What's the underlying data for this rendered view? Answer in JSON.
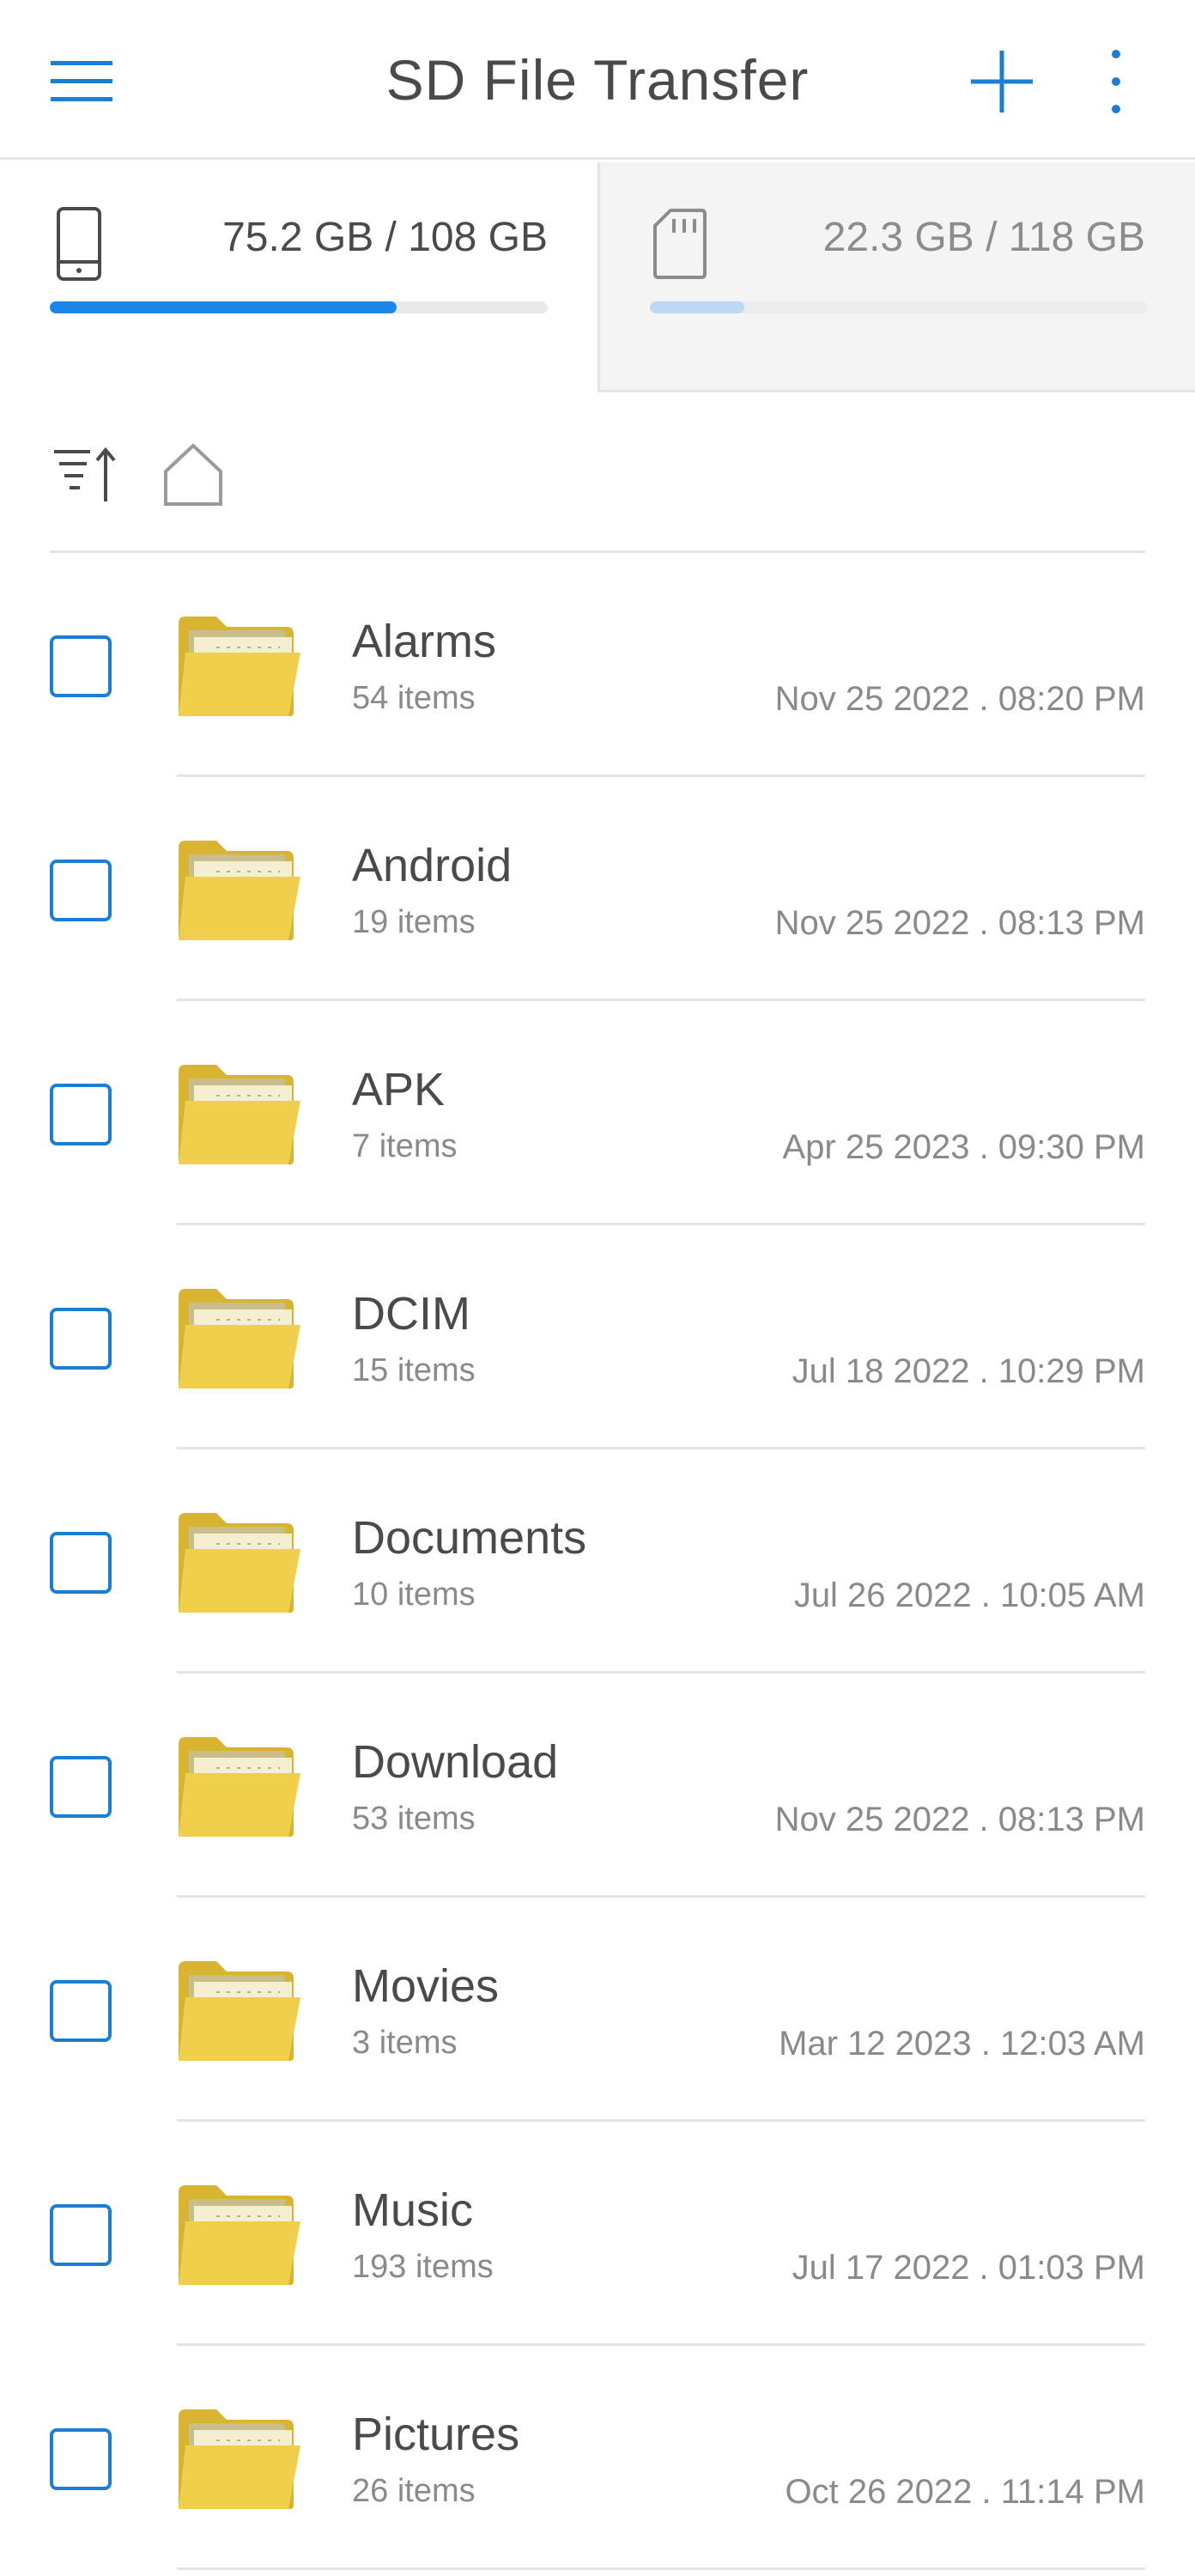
{
  "header": {
    "title": "SD File Transfer",
    "menu_icon": "hamburger-menu-icon",
    "add_icon": "plus-icon",
    "more_icon": "more-vertical-icon"
  },
  "storage": {
    "internal": {
      "icon": "phone-icon",
      "usage_text": "75.2 GB / 108 GB",
      "fraction_used": 0.696,
      "active": true
    },
    "sd": {
      "icon": "sd-card-icon",
      "usage_text": "22.3 GB / 118 GB",
      "fraction_used": 0.189,
      "active": false
    }
  },
  "toolbar": {
    "sort_icon": "sort-icon",
    "home_icon": "home-icon"
  },
  "colors": {
    "accent": "#1a7fd4",
    "progress_active": "#1a86e8",
    "progress_inactive": "#bcd8f2",
    "folder": "#f0cf4a",
    "text_primary": "#4a4a4a",
    "text_secondary": "#8a8a8a"
  },
  "files": [
    {
      "name": "Alarms",
      "count": "54 items",
      "date": "Nov 25 2022 . 08:20 PM"
    },
    {
      "name": "Android",
      "count": "19 items",
      "date": "Nov 25 2022 . 08:13 PM"
    },
    {
      "name": "APK",
      "count": "7 items",
      "date": "Apr 25 2023 . 09:30 PM"
    },
    {
      "name": "DCIM",
      "count": "15 items",
      "date": "Jul 18 2022 . 10:29 PM"
    },
    {
      "name": "Documents",
      "count": "10 items",
      "date": "Jul 26 2022 . 10:05 AM"
    },
    {
      "name": "Download",
      "count": "53 items",
      "date": "Nov 25 2022 . 08:13 PM"
    },
    {
      "name": "Movies",
      "count": "3 items",
      "date": "Mar 12 2023 . 12:03 AM"
    },
    {
      "name": "Music",
      "count": "193 items",
      "date": "Jul 17 2022 . 01:03 PM"
    },
    {
      "name": "Pictures",
      "count": "26 items",
      "date": "Oct 26 2022 . 11:14 PM"
    }
  ]
}
